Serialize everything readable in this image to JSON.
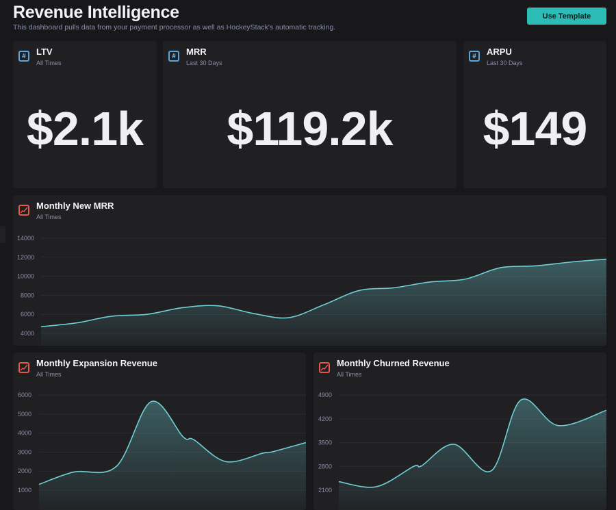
{
  "header": {
    "title": "Revenue Intelligence",
    "subtitle": "This dashboard pulls data from your payment processor as well as HockeyStack's automatic tracking.",
    "use_template_label": "Use Template"
  },
  "colors": {
    "accent": "#2bbcb5",
    "line": "#6fcfd3",
    "metric_icon": "#5aa7e0",
    "chart_icon": "#e8574d"
  },
  "metrics": [
    {
      "title": "LTV",
      "period": "All Times",
      "value": "$2.1k",
      "icon": "hash-icon"
    },
    {
      "title": "MRR",
      "period": "Last 30 Days",
      "value": "$119.2k",
      "icon": "hash-icon"
    },
    {
      "title": "ARPU",
      "period": "Last 30 Days",
      "value": "$149",
      "icon": "hash-icon"
    }
  ],
  "chart_data": [
    {
      "type": "area",
      "title": "Monthly New MRR",
      "subtitle": "All Times",
      "ylim": [
        4000,
        14000
      ],
      "yticks": [
        4000,
        6000,
        8000,
        10000,
        12000,
        14000
      ],
      "x": [
        0,
        1,
        2,
        3,
        4,
        5,
        6,
        7,
        8,
        9,
        10,
        11,
        12,
        13,
        14,
        15,
        16
      ],
      "values": [
        4700,
        5100,
        5800,
        6000,
        6700,
        6900,
        6100,
        5650,
        7000,
        8500,
        8800,
        9400,
        9700,
        10900,
        11100,
        11500,
        11800
      ]
    },
    {
      "type": "area",
      "title": "Monthly Expansion Revenue",
      "subtitle": "All Times",
      "ylim": [
        1000,
        6000
      ],
      "yticks": [
        1000,
        2000,
        3000,
        4000,
        5000,
        6000
      ],
      "x": [
        0,
        13,
        29,
        42,
        54,
        58,
        70,
        84,
        87,
        100
      ],
      "values": [
        1300,
        1950,
        2250,
        5650,
        3800,
        3650,
        2500,
        2950,
        3000,
        3500
      ]
    },
    {
      "type": "area",
      "title": "Monthly Churned Revenue",
      "subtitle": "All Times",
      "ylim": [
        2100,
        4900
      ],
      "yticks": [
        2100,
        2800,
        3500,
        4200,
        4900
      ],
      "x": [
        0,
        14,
        28,
        31,
        43,
        57,
        68,
        82,
        100
      ],
      "values": [
        2350,
        2200,
        2800,
        2820,
        3450,
        2670,
        4750,
        4000,
        4450
      ]
    }
  ]
}
